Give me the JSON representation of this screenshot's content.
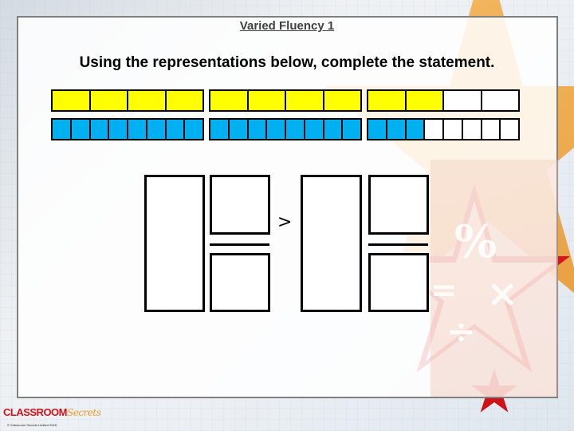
{
  "slide": {
    "title": "Varied Fluency 1",
    "instruction": "Using the representations below, complete the statement."
  },
  "representations": [
    {
      "name": "yellow-bar-model",
      "color": "#ffff00",
      "parts_per_whole": 4,
      "wholes": [
        {
          "filled": 4,
          "total": 4
        },
        {
          "filled": 4,
          "total": 4
        },
        {
          "filled": 2,
          "total": 4
        }
      ]
    },
    {
      "name": "blue-bar-model",
      "color": "#00b0f0",
      "parts_per_whole": 8,
      "wholes": [
        {
          "filled": 8,
          "total": 8
        },
        {
          "filled": 8,
          "total": 8
        },
        {
          "filled": 3,
          "total": 8
        }
      ]
    }
  ],
  "statement": {
    "left": {
      "whole": "",
      "numerator": "",
      "denominator": ""
    },
    "comparison": ">",
    "right": {
      "whole": "",
      "numerator": "",
      "denominator": ""
    }
  },
  "background_symbols": [
    "%",
    "=",
    "×",
    "÷"
  ],
  "footer": {
    "logo_primary": "CLASSROOM",
    "logo_secondary": "Secrets",
    "copyright": "© Classroom Secrets Limited 2018"
  }
}
